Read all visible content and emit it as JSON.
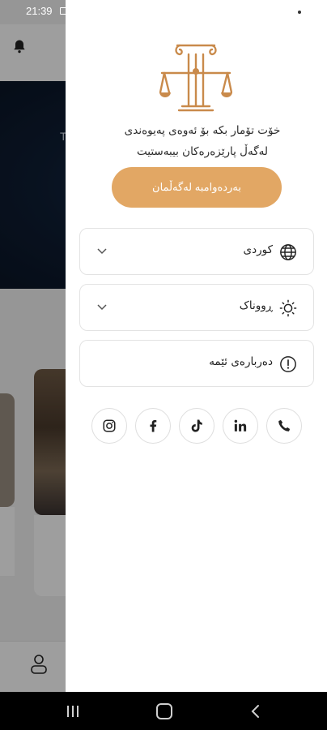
{
  "status_bar": {
    "time": "21:39"
  },
  "background": {
    "hero_char": "T"
  },
  "drawer": {
    "tagline_line1": "خۆت تۆمار بکە بۆ ئەوەی پەیوەندی",
    "tagline_line2": "لەگەڵ پارێزەرەکان بیبەستیت",
    "continue_label": "بەردەوامبە لەگەڵمان",
    "rows": [
      {
        "label": "کوردی",
        "icon": "globe-icon",
        "has_chevron": true
      },
      {
        "label": "ڕووناک",
        "icon": "sun-icon",
        "has_chevron": true
      },
      {
        "label": "دەربارەی ئێمە",
        "icon": "info-icon",
        "has_chevron": false
      }
    ],
    "social": [
      "phone-icon",
      "linkedin-icon",
      "tiktok-icon",
      "facebook-icon",
      "instagram-icon"
    ],
    "accent_color": "#e2a764"
  }
}
